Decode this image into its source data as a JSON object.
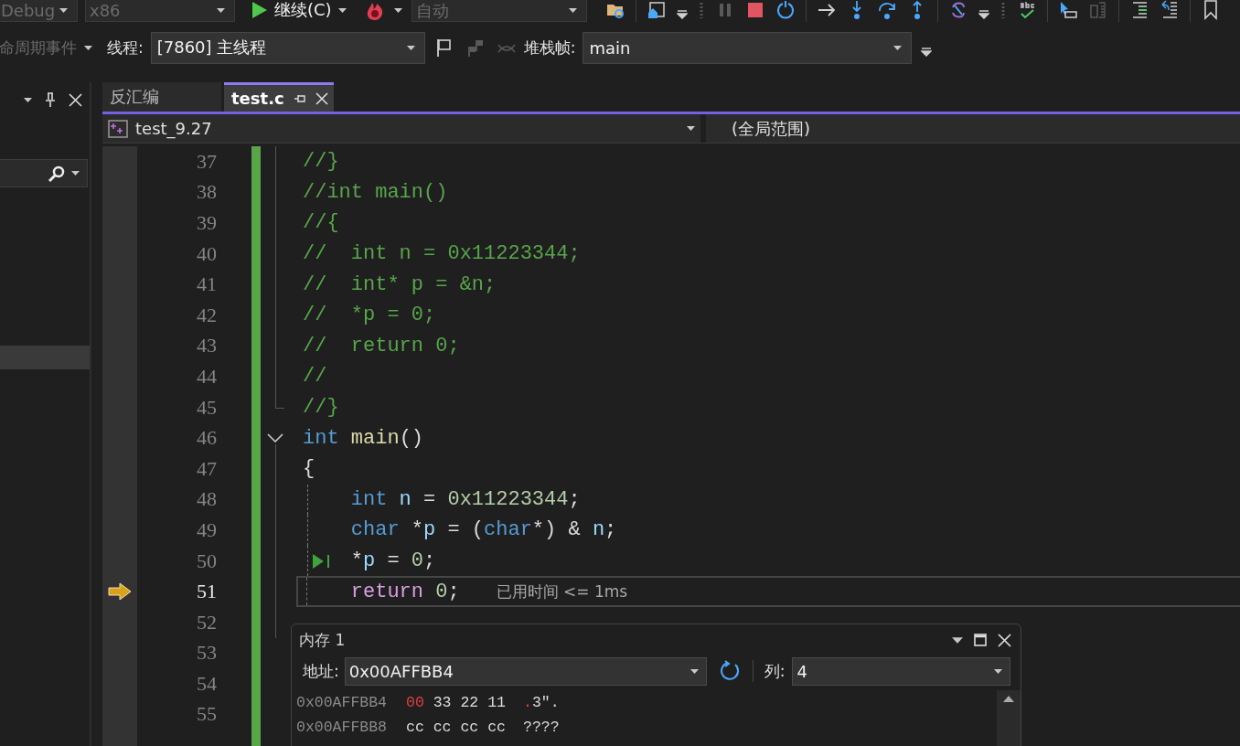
{
  "toolbar": {
    "configuration": {
      "value": "Debug",
      "disabled": true
    },
    "platform": {
      "value": "x86",
      "disabled": true
    },
    "continue": {
      "label": "继续(C)"
    },
    "mode": {
      "value": "自动",
      "disabled": true
    },
    "icons": [
      {
        "kind": "folder-search",
        "disabled": false
      },
      {
        "kind": "sep"
      },
      {
        "kind": "home-window",
        "disabled": false
      },
      {
        "kind": "overflow",
        "disabled": false
      },
      {
        "kind": "grip",
        "disabled": false
      },
      {
        "kind": "pause",
        "disabled": true
      },
      {
        "kind": "stop",
        "disabled": false
      },
      {
        "kind": "restart",
        "disabled": false
      },
      {
        "kind": "sep"
      },
      {
        "kind": "arrow-right",
        "disabled": false
      },
      {
        "kind": "step-into",
        "disabled": false
      },
      {
        "kind": "step-over",
        "disabled": false
      },
      {
        "kind": "step-out",
        "disabled": false
      },
      {
        "kind": "sep"
      },
      {
        "kind": "link",
        "disabled": false
      },
      {
        "kind": "overflow",
        "disabled": false
      },
      {
        "kind": "grip",
        "disabled": false
      },
      {
        "kind": "spell",
        "disabled": false
      },
      {
        "kind": "sep"
      },
      {
        "kind": "cursor",
        "disabled": false
      },
      {
        "kind": "copy",
        "disabled": true
      },
      {
        "kind": "sep"
      },
      {
        "kind": "lines-green",
        "disabled": false
      },
      {
        "kind": "lines-blue",
        "disabled": false
      },
      {
        "kind": "sep"
      },
      {
        "kind": "bookmark",
        "disabled": false
      }
    ]
  },
  "debug_location": {
    "lifecycle": {
      "value": "命周期事件",
      "disabled": true
    },
    "thread_label": "线程:",
    "thread": "[7860] 主线程",
    "flag_icons": [
      {
        "kind": "flag",
        "disabled": false
      },
      {
        "kind": "flags",
        "disabled": true
      },
      {
        "kind": "switch",
        "disabled": true
      }
    ],
    "frame_label": "堆栈帧:",
    "frame": "main"
  },
  "tabs": [
    {
      "label": "反汇编",
      "selected": false
    },
    {
      "label": "test.c",
      "selected": true
    }
  ],
  "navigation": {
    "project": "test_9.27",
    "scope": "(全局范围)"
  },
  "lines": [
    {
      "n": "37",
      "fold": {
        "kind": "inner"
      },
      "guide": false,
      "current": false,
      "marker": false,
      "code": [
        {
          "t": "//}",
          "kind": "comment"
        }
      ]
    },
    {
      "n": "38",
      "fold": {
        "kind": "inner"
      },
      "guide": false,
      "current": false,
      "marker": false,
      "code": [
        {
          "t": "//int main()",
          "kind": "comment"
        }
      ]
    },
    {
      "n": "39",
      "fold": {
        "kind": "inner"
      },
      "guide": false,
      "current": false,
      "marker": false,
      "code": [
        {
          "t": "//{",
          "kind": "comment"
        }
      ]
    },
    {
      "n": "40",
      "fold": {
        "kind": "inner"
      },
      "guide": false,
      "current": false,
      "marker": false,
      "code": [
        {
          "t": "//  int n = 0x11223344;",
          "kind": "comment"
        }
      ]
    },
    {
      "n": "41",
      "fold": {
        "kind": "inner"
      },
      "guide": false,
      "current": false,
      "marker": false,
      "code": [
        {
          "t": "//  int* p = &n;",
          "kind": "comment"
        }
      ]
    },
    {
      "n": "42",
      "fold": {
        "kind": "inner"
      },
      "guide": false,
      "current": false,
      "marker": false,
      "code": [
        {
          "t": "//  *p = 0;",
          "kind": "comment"
        }
      ]
    },
    {
      "n": "43",
      "fold": {
        "kind": "inner"
      },
      "guide": false,
      "current": false,
      "marker": false,
      "code": [
        {
          "t": "//  return 0;",
          "kind": "comment"
        }
      ]
    },
    {
      "n": "44",
      "fold": {
        "kind": "inner"
      },
      "guide": false,
      "current": false,
      "marker": false,
      "code": [
        {
          "t": "//",
          "kind": "comment"
        }
      ]
    },
    {
      "n": "45",
      "fold": {
        "kind": "end"
      },
      "guide": false,
      "current": false,
      "marker": false,
      "code": [
        {
          "t": "//}",
          "kind": "comment"
        }
      ]
    },
    {
      "n": "46",
      "fold": {
        "kind": "start"
      },
      "guide": false,
      "current": false,
      "marker": false,
      "code": [
        {
          "t": "int",
          "kind": "keyword"
        },
        {
          "t": " main",
          "kind": "func"
        },
        {
          "t": "()",
          "kind": "plain"
        }
      ]
    },
    {
      "n": "47",
      "fold": {
        "kind": "inner"
      },
      "guide": false,
      "current": false,
      "marker": false,
      "code": [
        {
          "t": "{",
          "kind": "plain"
        }
      ]
    },
    {
      "n": "48",
      "fold": {
        "kind": "inner"
      },
      "guide": true,
      "current": false,
      "marker": false,
      "code": [
        {
          "t": "    int",
          "kind": "keyword"
        },
        {
          "t": " n",
          "kind": "var"
        },
        {
          "t": " = ",
          "kind": "plain"
        },
        {
          "t": "0x11223344",
          "kind": "number"
        },
        {
          "t": ";",
          "kind": "plain"
        }
      ]
    },
    {
      "n": "49",
      "fold": {
        "kind": "inner"
      },
      "guide": true,
      "current": false,
      "marker": false,
      "code": [
        {
          "t": "    char",
          "kind": "keyword"
        },
        {
          "t": " *",
          "kind": "plain"
        },
        {
          "t": "p",
          "kind": "var"
        },
        {
          "t": " = (",
          "kind": "plain"
        },
        {
          "t": "char",
          "kind": "keyword"
        },
        {
          "t": "*) & ",
          "kind": "plain"
        },
        {
          "t": "n",
          "kind": "var"
        },
        {
          "t": ";",
          "kind": "plain"
        }
      ]
    },
    {
      "n": "50",
      "fold": {
        "kind": "inner"
      },
      "guide": true,
      "current": false,
      "marker": true,
      "code": [
        {
          "t": "    *",
          "kind": "plain"
        },
        {
          "t": "p",
          "kind": "var"
        },
        {
          "t": " = ",
          "kind": "plain"
        },
        {
          "t": "0",
          "kind": "number"
        },
        {
          "t": ";",
          "kind": "plain"
        }
      ]
    },
    {
      "n": "51",
      "fold": {
        "kind": "inner"
      },
      "guide": true,
      "current": true,
      "marker": false,
      "hint": "已用时间 <= 1ms",
      "code": [
        {
          "t": "    return",
          "kind": "control"
        },
        {
          "t": " 0",
          "kind": "number"
        },
        {
          "t": ";",
          "kind": "plain"
        }
      ]
    },
    {
      "n": "52",
      "fold": {
        "kind": "inner"
      },
      "guide": false,
      "current": false,
      "marker": false
    },
    {
      "n": "53",
      "fold": {
        "kind": "none"
      },
      "guide": false,
      "current": false,
      "marker": false
    },
    {
      "n": "54",
      "fold": {
        "kind": "none"
      },
      "guide": false,
      "current": false,
      "marker": false
    },
    {
      "n": "55",
      "fold": {
        "kind": "none"
      },
      "guide": false,
      "current": false,
      "marker": false
    }
  ],
  "memory": {
    "title": "内存 1",
    "address_label": "地址:",
    "address": "0x00AFFBB4",
    "columns_label": "列:",
    "columns": "4",
    "rows": [
      {
        "address": "0x00AFFBB4",
        "bytes": [
          {
            "v": "00",
            "changed": true
          },
          {
            "v": "33",
            "changed": false
          },
          {
            "v": "22",
            "changed": false
          },
          {
            "v": "11",
            "changed": false
          }
        ],
        "chars": [
          {
            "v": ".",
            "changed": true
          },
          {
            "v": "3″.",
            "changed": false
          }
        ]
      },
      {
        "address": "0x00AFFBB8",
        "bytes": [
          {
            "v": "cc",
            "changed": false
          },
          {
            "v": "cc",
            "changed": false
          },
          {
            "v": "cc",
            "changed": false
          },
          {
            "v": "cc",
            "changed": false
          }
        ],
        "chars": [
          {
            "v": "????",
            "changed": false
          }
        ]
      }
    ]
  }
}
